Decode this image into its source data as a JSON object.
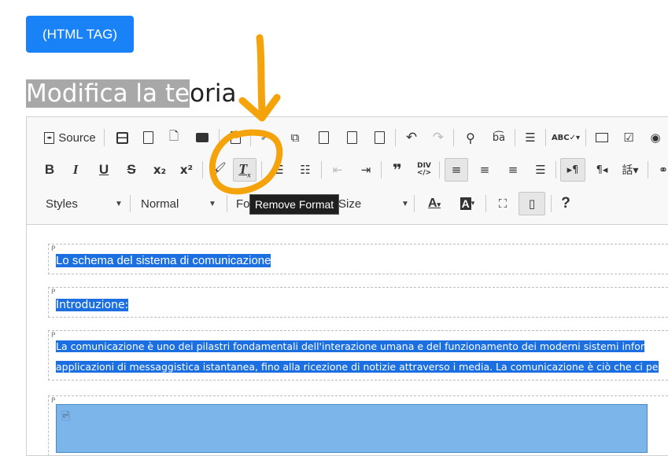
{
  "header": {
    "html_tag_button": "(HTML TAG)",
    "title_selected": "Modifica la te",
    "title_rest": "oria"
  },
  "toolbar": {
    "source_label": "Source",
    "combos": {
      "styles": "Styles",
      "format": "Normal",
      "font": "Fo",
      "size": "Size"
    },
    "tooltip": "Remove Format",
    "icons": [
      "source-icon",
      "save-icon",
      "new-page-icon",
      "preview-icon",
      "print-icon",
      "templates-icon",
      "cut-icon",
      "copy-icon",
      "paste-icon",
      "paste-text-icon",
      "paste-word-icon",
      "undo-icon",
      "redo-icon",
      "find-icon",
      "replace-icon",
      "select-all-icon",
      "spellcheck-icon",
      "form-icon",
      "checkbox-icon",
      "radio-icon",
      "bold-icon",
      "italic-icon",
      "underline-icon",
      "strike-icon",
      "subscript-icon",
      "superscript-icon",
      "copy-format-icon",
      "remove-format-icon",
      "numbered-list-icon",
      "bulleted-list-icon",
      "outdent-icon",
      "indent-icon",
      "blockquote-icon",
      "div-icon",
      "align-left-icon",
      "align-center-icon",
      "align-right-icon",
      "justify-icon",
      "ltr-icon",
      "rtl-icon",
      "language-icon",
      "link-icon",
      "text-color-icon",
      "bg-color-icon",
      "maximize-icon",
      "show-blocks-icon",
      "help-icon"
    ]
  },
  "content": {
    "block_tag": "P",
    "para1": "Lo schema del sistema di comunicazione",
    "para2": "Introduzione:",
    "para3_line1": "La comunicazione è uno dei pilastri fondamentali dell'interazione umana e del funzionamento dei moderni sistemi infor",
    "para3_line2": "applicazioni di messaggistica istantanea, fino alla ricezione di notizie attraverso i media. La comunicazione è ciò che ci pe"
  },
  "colors": {
    "primary_button": "#1a82f7",
    "selection": "#1b6fe0",
    "annotation": "#f5a30a"
  }
}
